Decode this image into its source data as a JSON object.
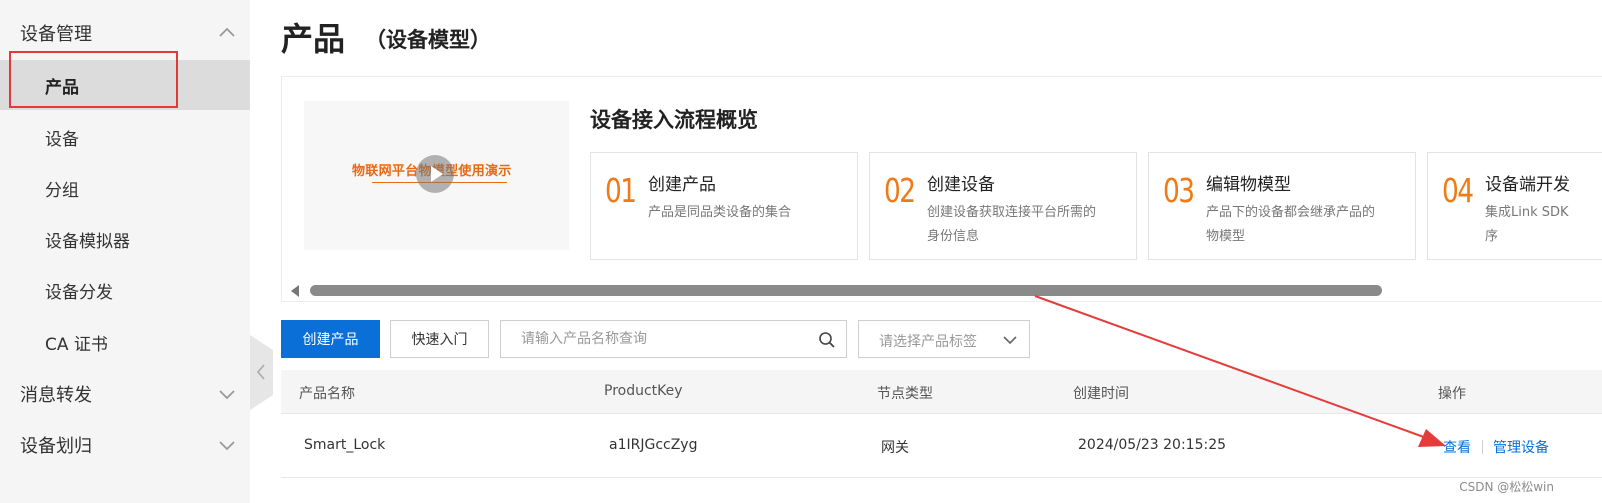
{
  "sidebar": {
    "group_device_mgmt": "设备管理",
    "items": [
      "产品",
      "设备",
      "分组",
      "设备模拟器",
      "设备分发",
      "CA 证书"
    ],
    "group_message": "消息转发",
    "group_device_assign": "设备划归",
    "active_index": 0
  },
  "header": {
    "title": "产品",
    "subtitle": "（设备模型）"
  },
  "overview": {
    "video_caption": "物联网平台物模型使用演示",
    "title": "设备接入流程概览",
    "steps": [
      {
        "num": "01",
        "title": "创建产品",
        "desc_1": "产品是同品类设备的集合",
        "desc_2": ""
      },
      {
        "num": "02",
        "title": "创建设备",
        "desc_1": "创建设备获取连接平台所需的",
        "desc_2": "身份信息"
      },
      {
        "num": "03",
        "title": "编辑物模型",
        "desc_1": "产品下的设备都会继承产品的",
        "desc_2": "物模型"
      },
      {
        "num": "04",
        "title": "设备端开发",
        "desc_1": "集成Link SDK",
        "desc_2": "序"
      }
    ]
  },
  "toolbar": {
    "create_label": "创建产品",
    "quickstart_label": "快速入门",
    "search_placeholder": "请输入产品名称查询",
    "tag_select_placeholder": "请选择产品标签"
  },
  "table": {
    "columns": [
      "产品名称",
      "ProductKey",
      "节点类型",
      "创建时间",
      "操作"
    ],
    "rows": [
      {
        "name": "Smart_Lock",
        "product_key": "a1IRJGccZyg",
        "node_type": "网关",
        "created": "2024/05/23 20:15:25",
        "action_view": "查看",
        "action_manage": "管理设备"
      }
    ]
  },
  "annotation": {
    "box_color": "#e03a3a",
    "arrow_color": "#e63b3b"
  },
  "colors": {
    "primary": "#0a6fd6",
    "accent": "#f07a16"
  },
  "watermark": "CSDN @松松win"
}
